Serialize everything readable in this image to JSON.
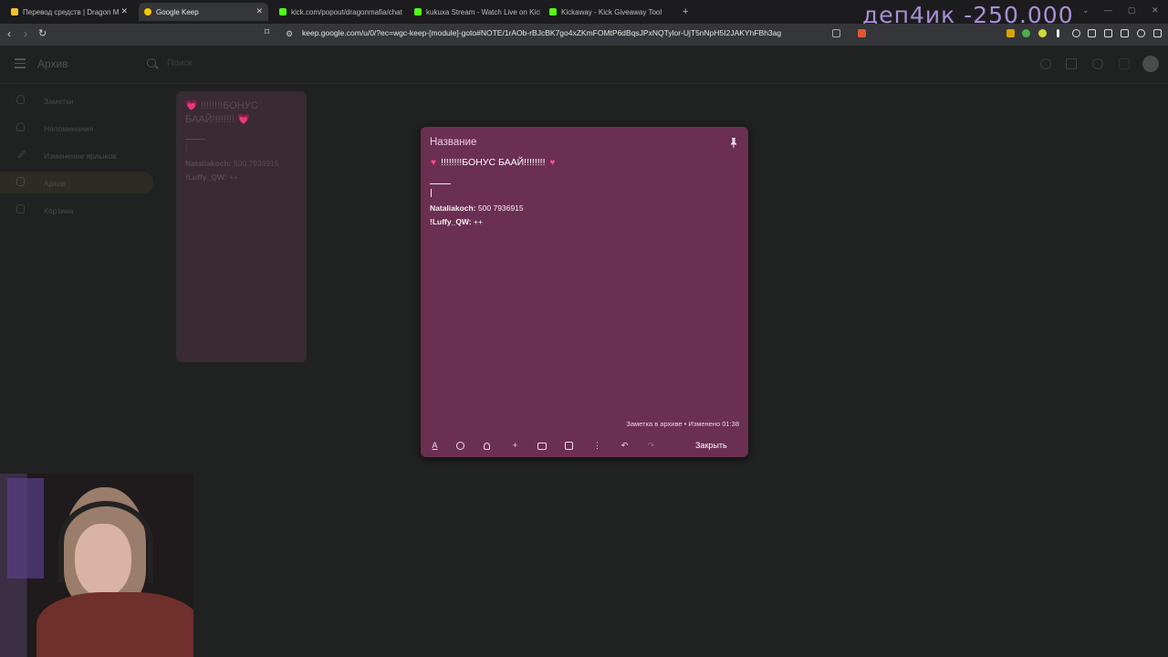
{
  "browser": {
    "tabs": [
      {
        "label": "Перевод средств | Dragon M",
        "color": "#f2c12e",
        "active": false
      },
      {
        "label": "Google Keep",
        "color": "#f7c800",
        "active": true
      },
      {
        "label": "kick.com/popout/dragonmafia/chat",
        "color": "#53fc18",
        "active": false
      },
      {
        "label": "kukuxa Stream - Watch Live on Kick",
        "color": "#53fc18",
        "active": false
      },
      {
        "label": "Kickaway - Kick Giveaway Tool",
        "color": "#53fc18",
        "active": false
      }
    ],
    "new_tab_glyph": "+",
    "url": "keep.google.com/u/0/?ec=wgc-keep-[module]-goto#NOTE/1rAOb-rBJcBK7go4xZKmFOMtP6dBqsJPxNQTylor-UjT5nNpH5I2JAKYhFBh3ag"
  },
  "overlay": {
    "stream_text": "деп4ик -250.000"
  },
  "keep": {
    "section_title": "Архив",
    "search_placeholder": "Поиск",
    "sidebar": [
      {
        "label": "Заметки",
        "icon": "bulb-icon",
        "active": false
      },
      {
        "label": "Напоминания",
        "icon": "bell-icon",
        "active": false
      },
      {
        "label": "Изменение ярлыков",
        "icon": "pencil-icon",
        "active": false
      },
      {
        "label": "Архив",
        "icon": "archive-icon",
        "active": true
      },
      {
        "label": "Корзина",
        "icon": "trash-icon",
        "active": false
      }
    ],
    "grid_note": {
      "title": "💗 !!!!!!!!БОНУС БААЙ!!!!!!!! 💗",
      "cursor": "|",
      "line1_user": "Nataliakoch:",
      "line1_value": "500 7936915",
      "line2_user": "!Luffy_QW:",
      "line2_value": "++"
    },
    "modal": {
      "title_placeholder": "Название",
      "heading_text": "!!!!!!!!БОНУС БААЙ!!!!!!!!",
      "line1_user": "Nataliakoch:",
      "line1_value": "500 7936915",
      "line2_user": "!Luffy_QW:",
      "line2_value": "++",
      "meta": "Заметка в архиве  •  Изменено 01:38",
      "close_label": "Закрыть",
      "background": "#6b2f52"
    }
  }
}
